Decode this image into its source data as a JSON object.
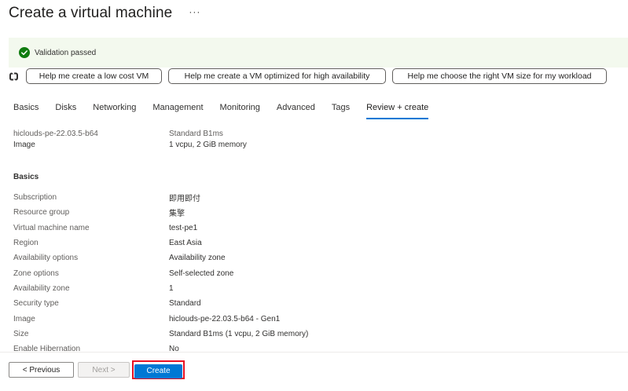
{
  "header": {
    "title": "Create a virtual machine",
    "more_label": "···"
  },
  "banner": {
    "icon": "check-circle-icon",
    "text": "Validation passed",
    "color": "#107c10"
  },
  "copilot": {
    "icon": "copilot-icon",
    "suggestions": [
      "Help me create a low cost VM",
      "Help me create a VM optimized for high availability",
      "Help me choose the right VM size for my workload"
    ]
  },
  "tabs": [
    "Basics",
    "Disks",
    "Networking",
    "Management",
    "Monitoring",
    "Advanced",
    "Tags",
    "Review + create"
  ],
  "active_tab": "Review + create",
  "summary": {
    "image_name": "hiclouds-pe-22.03.5-b64",
    "image_label": "Image",
    "size_name": "Standard B1ms",
    "size_detail": "1 vcpu, 2 GiB memory"
  },
  "basics": {
    "heading": "Basics",
    "rows": [
      {
        "label": "Subscription",
        "value": "即用即付"
      },
      {
        "label": "Resource group",
        "value": "集擎"
      },
      {
        "label": "Virtual machine name",
        "value": "test-pe1"
      },
      {
        "label": "Region",
        "value": "East Asia"
      },
      {
        "label": "Availability options",
        "value": "Availability zone"
      },
      {
        "label": "Zone options",
        "value": "Self-selected zone"
      },
      {
        "label": "Availability zone",
        "value": "1"
      },
      {
        "label": "Security type",
        "value": "Standard"
      },
      {
        "label": "Image",
        "value": "hiclouds-pe-22.03.5-b64 - Gen1"
      },
      {
        "label": "Size",
        "value": "Standard B1ms (1 vcpu, 2 GiB memory)"
      },
      {
        "label": "Enable Hibernation",
        "value": "No"
      }
    ]
  },
  "footer": {
    "previous_label": "< Previous",
    "next_label": "Next >",
    "create_label": "Create",
    "accent": "#0078d4",
    "highlight": "#e81123"
  }
}
